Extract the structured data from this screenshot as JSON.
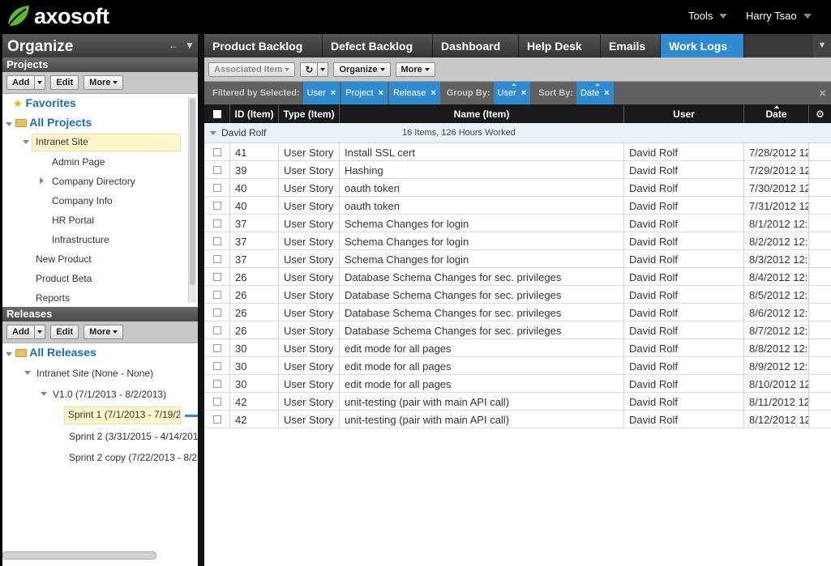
{
  "topbar": {
    "brand": "axosoft",
    "tools_label": "Tools",
    "user_label": "Harry Tsao"
  },
  "left": {
    "title": "Organize",
    "projects": {
      "header": "Projects",
      "add_label": "Add",
      "edit_label": "Edit",
      "more_label": "More",
      "favorites": "Favorites",
      "all_projects": "All Projects",
      "selected": "Intranet Site",
      "children": [
        "Admin Page",
        "Company Directory",
        "Company Info",
        "HR Portal",
        "Infrastructure"
      ],
      "top_level": [
        "New Product",
        "Product Beta",
        "Reports"
      ]
    },
    "releases": {
      "header": "Releases",
      "add_label": "Add",
      "edit_label": "Edit",
      "more_label": "More",
      "all_releases": "All Releases",
      "project": "Intranet Site (None - None)",
      "version": "V1.0 (7/1/2013 - 8/2/2013)",
      "sprints": [
        "Sprint 1 (7/1/2013 - 7/19/2",
        "Sprint 2 (3/31/2015 - 4/14/201",
        "Sprint 2 copy (7/22/2013 - 8/2"
      ]
    }
  },
  "tabs": [
    "Product Backlog",
    "Defect Backlog",
    "Dashboard",
    "Help Desk",
    "Emails",
    "Work Logs"
  ],
  "active_tab": "Work Logs",
  "toolbar": {
    "associated_item": "Associated Item",
    "organize": "Organize",
    "more": "More"
  },
  "filterbar": {
    "filtered_by": "Filtered by Selected:",
    "filters": [
      "User",
      "Project",
      "Release"
    ],
    "group_by": "Group By:",
    "group_value": "User",
    "sort_by": "Sort By:",
    "sort_value": "Date"
  },
  "grid": {
    "columns": [
      "ID (Item)",
      "Type (Item)",
      "Name (Item)",
      "User",
      "Date"
    ],
    "group": {
      "name": "David Rolf",
      "summary": "16 Items, 126 Hours Worked"
    },
    "rows": [
      [
        "41",
        "User Story",
        "Install SSL cert",
        "David Rolf",
        "7/28/2012 12"
      ],
      [
        "39",
        "User Story",
        "Hashing",
        "David Rolf",
        "7/29/2012 12"
      ],
      [
        "40",
        "User Story",
        "oauth token",
        "David Rolf",
        "7/30/2012 12"
      ],
      [
        "40",
        "User Story",
        "oauth token",
        "David Rolf",
        "7/31/2012 12"
      ],
      [
        "37",
        "User Story",
        "Schema Changes for login",
        "David Rolf",
        "8/1/2012 12:"
      ],
      [
        "37",
        "User Story",
        "Schema Changes for login",
        "David Rolf",
        "8/2/2012 12:"
      ],
      [
        "37",
        "User Story",
        "Schema Changes for login",
        "David Rolf",
        "8/3/2012 12:"
      ],
      [
        "26",
        "User Story",
        "Database Schema Changes for sec. privileges",
        "David Rolf",
        "8/4/2012 12:"
      ],
      [
        "26",
        "User Story",
        "Database Schema Changes for sec. privileges",
        "David Rolf",
        "8/5/2012 12:"
      ],
      [
        "26",
        "User Story",
        "Database Schema Changes for sec. privileges",
        "David Rolf",
        "8/6/2012 12:"
      ],
      [
        "26",
        "User Story",
        "Database Schema Changes for sec. privileges",
        "David Rolf",
        "8/7/2012 12:"
      ],
      [
        "30",
        "User Story",
        "edit mode for all pages",
        "David Rolf",
        "8/8/2012 12:"
      ],
      [
        "30",
        "User Story",
        "edit mode for all pages",
        "David Rolf",
        "8/9/2012 12:"
      ],
      [
        "30",
        "User Story",
        "edit mode for all pages",
        "David Rolf",
        "8/10/2012 12"
      ],
      [
        "42",
        "User Story",
        "unit-testing (pair with main API call)",
        "David Rolf",
        "8/11/2012 12"
      ],
      [
        "42",
        "User Story",
        "unit-testing (pair with main API call)",
        "David Rolf",
        "8/12/2012 12"
      ]
    ]
  },
  "colors": {
    "accent": "#2f8bd0",
    "tree_link": "#1a6fb8",
    "selection": "#fff6cc"
  }
}
